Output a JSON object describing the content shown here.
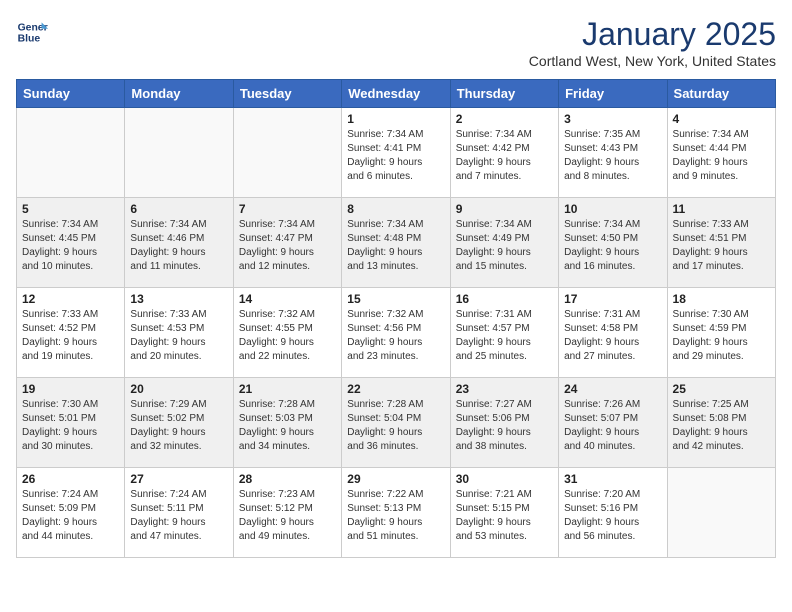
{
  "logo": {
    "line1": "General",
    "line2": "Blue"
  },
  "header": {
    "month": "January 2025",
    "location": "Cortland West, New York, United States"
  },
  "weekdays": [
    "Sunday",
    "Monday",
    "Tuesday",
    "Wednesday",
    "Thursday",
    "Friday",
    "Saturday"
  ],
  "weeks": [
    {
      "shaded": false,
      "days": [
        {
          "num": "",
          "info": ""
        },
        {
          "num": "",
          "info": ""
        },
        {
          "num": "",
          "info": ""
        },
        {
          "num": "1",
          "info": "Sunrise: 7:34 AM\nSunset: 4:41 PM\nDaylight: 9 hours\nand 6 minutes."
        },
        {
          "num": "2",
          "info": "Sunrise: 7:34 AM\nSunset: 4:42 PM\nDaylight: 9 hours\nand 7 minutes."
        },
        {
          "num": "3",
          "info": "Sunrise: 7:35 AM\nSunset: 4:43 PM\nDaylight: 9 hours\nand 8 minutes."
        },
        {
          "num": "4",
          "info": "Sunrise: 7:34 AM\nSunset: 4:44 PM\nDaylight: 9 hours\nand 9 minutes."
        }
      ]
    },
    {
      "shaded": true,
      "days": [
        {
          "num": "5",
          "info": "Sunrise: 7:34 AM\nSunset: 4:45 PM\nDaylight: 9 hours\nand 10 minutes."
        },
        {
          "num": "6",
          "info": "Sunrise: 7:34 AM\nSunset: 4:46 PM\nDaylight: 9 hours\nand 11 minutes."
        },
        {
          "num": "7",
          "info": "Sunrise: 7:34 AM\nSunset: 4:47 PM\nDaylight: 9 hours\nand 12 minutes."
        },
        {
          "num": "8",
          "info": "Sunrise: 7:34 AM\nSunset: 4:48 PM\nDaylight: 9 hours\nand 13 minutes."
        },
        {
          "num": "9",
          "info": "Sunrise: 7:34 AM\nSunset: 4:49 PM\nDaylight: 9 hours\nand 15 minutes."
        },
        {
          "num": "10",
          "info": "Sunrise: 7:34 AM\nSunset: 4:50 PM\nDaylight: 9 hours\nand 16 minutes."
        },
        {
          "num": "11",
          "info": "Sunrise: 7:33 AM\nSunset: 4:51 PM\nDaylight: 9 hours\nand 17 minutes."
        }
      ]
    },
    {
      "shaded": false,
      "days": [
        {
          "num": "12",
          "info": "Sunrise: 7:33 AM\nSunset: 4:52 PM\nDaylight: 9 hours\nand 19 minutes."
        },
        {
          "num": "13",
          "info": "Sunrise: 7:33 AM\nSunset: 4:53 PM\nDaylight: 9 hours\nand 20 minutes."
        },
        {
          "num": "14",
          "info": "Sunrise: 7:32 AM\nSunset: 4:55 PM\nDaylight: 9 hours\nand 22 minutes."
        },
        {
          "num": "15",
          "info": "Sunrise: 7:32 AM\nSunset: 4:56 PM\nDaylight: 9 hours\nand 23 minutes."
        },
        {
          "num": "16",
          "info": "Sunrise: 7:31 AM\nSunset: 4:57 PM\nDaylight: 9 hours\nand 25 minutes."
        },
        {
          "num": "17",
          "info": "Sunrise: 7:31 AM\nSunset: 4:58 PM\nDaylight: 9 hours\nand 27 minutes."
        },
        {
          "num": "18",
          "info": "Sunrise: 7:30 AM\nSunset: 4:59 PM\nDaylight: 9 hours\nand 29 minutes."
        }
      ]
    },
    {
      "shaded": true,
      "days": [
        {
          "num": "19",
          "info": "Sunrise: 7:30 AM\nSunset: 5:01 PM\nDaylight: 9 hours\nand 30 minutes."
        },
        {
          "num": "20",
          "info": "Sunrise: 7:29 AM\nSunset: 5:02 PM\nDaylight: 9 hours\nand 32 minutes."
        },
        {
          "num": "21",
          "info": "Sunrise: 7:28 AM\nSunset: 5:03 PM\nDaylight: 9 hours\nand 34 minutes."
        },
        {
          "num": "22",
          "info": "Sunrise: 7:28 AM\nSunset: 5:04 PM\nDaylight: 9 hours\nand 36 minutes."
        },
        {
          "num": "23",
          "info": "Sunrise: 7:27 AM\nSunset: 5:06 PM\nDaylight: 9 hours\nand 38 minutes."
        },
        {
          "num": "24",
          "info": "Sunrise: 7:26 AM\nSunset: 5:07 PM\nDaylight: 9 hours\nand 40 minutes."
        },
        {
          "num": "25",
          "info": "Sunrise: 7:25 AM\nSunset: 5:08 PM\nDaylight: 9 hours\nand 42 minutes."
        }
      ]
    },
    {
      "shaded": false,
      "days": [
        {
          "num": "26",
          "info": "Sunrise: 7:24 AM\nSunset: 5:09 PM\nDaylight: 9 hours\nand 44 minutes."
        },
        {
          "num": "27",
          "info": "Sunrise: 7:24 AM\nSunset: 5:11 PM\nDaylight: 9 hours\nand 47 minutes."
        },
        {
          "num": "28",
          "info": "Sunrise: 7:23 AM\nSunset: 5:12 PM\nDaylight: 9 hours\nand 49 minutes."
        },
        {
          "num": "29",
          "info": "Sunrise: 7:22 AM\nSunset: 5:13 PM\nDaylight: 9 hours\nand 51 minutes."
        },
        {
          "num": "30",
          "info": "Sunrise: 7:21 AM\nSunset: 5:15 PM\nDaylight: 9 hours\nand 53 minutes."
        },
        {
          "num": "31",
          "info": "Sunrise: 7:20 AM\nSunset: 5:16 PM\nDaylight: 9 hours\nand 56 minutes."
        },
        {
          "num": "",
          "info": ""
        }
      ]
    }
  ]
}
